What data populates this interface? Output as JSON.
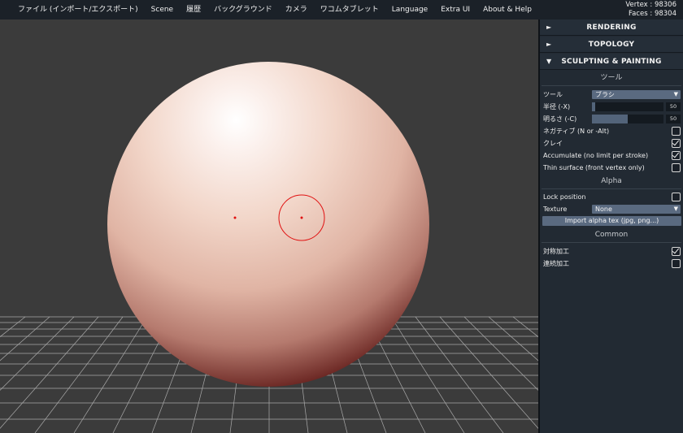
{
  "menu": {
    "items": [
      "ファイル (インポート/エクスポート)",
      "Scene",
      "履歴",
      "バックグラウンド",
      "カメラ",
      "ワコムタブレット",
      "Language",
      "Extra UI",
      "About & Help"
    ]
  },
  "stats": {
    "vertex": "Vertex : 98306",
    "faces": "Faces : 98304"
  },
  "panel": {
    "folders": {
      "rendering": "RENDERING",
      "topology": "TOPOLOGY",
      "sculpting": "SCULPTING & PAINTING"
    },
    "tool_section": "ツール",
    "tool_label": "ツール",
    "tool_value": "ブラシ",
    "radius_label": "半径 (-X)",
    "radius_value": "50",
    "radius_fraction": 0.05,
    "intensity_label": "明るさ (-C)",
    "intensity_value": "50",
    "intensity_fraction": 0.5,
    "negative_label": "ネガティブ (N or -Alt)",
    "negative_checked": false,
    "clay_label": "クレイ",
    "clay_checked": true,
    "accumulate_label": "Accumulate (no limit per stroke)",
    "accumulate_checked": true,
    "thin_label": "Thin surface (front vertex only)",
    "thin_checked": false,
    "alpha_section": "Alpha",
    "lock_label": "Lock position",
    "lock_checked": false,
    "texture_label": "Texture",
    "texture_value": "None",
    "import_alpha_label": "Import alpha tex (jpg, png...)",
    "common_section": "Common",
    "symmetry_label": "対称加工",
    "symmetry_checked": true,
    "continuous_label": "連続加工",
    "continuous_checked": false
  },
  "icons": {
    "collapsed": "arrow-right-icon",
    "expanded": "arrow-down-icon",
    "dropdown": "caret-down-icon"
  },
  "colors": {
    "menubar": "#1b2128",
    "panel": "#222a33",
    "viewport": "#3b3b3b",
    "accent": "#5a6a80",
    "brush_cursor": "#e01010"
  }
}
